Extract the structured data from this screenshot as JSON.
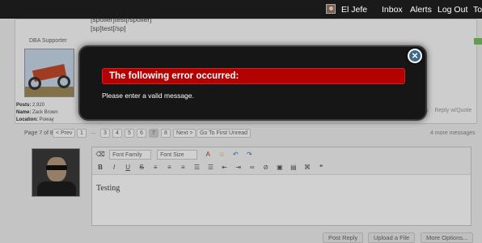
{
  "topbar": {
    "user_name": "El Jefe",
    "inbox": "Inbox",
    "alerts": "Alerts",
    "logout": "Log Out",
    "top": "To"
  },
  "post": {
    "user_title": "DBA Supporter",
    "quote_line_1": "[spoiler]test[/spoiler]",
    "quote_line_2": "[sp]test[/sp]",
    "posts_label": "Posts:",
    "posts_value": "2,920",
    "name_label": "Name:",
    "name_value": "Zack Brown",
    "location_label": "Location:",
    "location_value": "Poway",
    "likes_fragment": "es",
    "reply_quote": "Reply w/Quote"
  },
  "pagination": {
    "label": "Page 7 of 8",
    "prev": "< Prev",
    "pages": [
      "1",
      "…",
      "3",
      "4",
      "5",
      "6",
      "7",
      "8"
    ],
    "current_page": "7",
    "next": "Next >",
    "first_unread": "Go To First Unread",
    "more_messages": "4 more messages"
  },
  "editor": {
    "font_family": "Font Family",
    "font_size": "Font Size",
    "text": "Testing"
  },
  "form_buttons": {
    "post_reply": "Post Reply",
    "upload": "Upload a File",
    "more_options": "More Options..."
  },
  "modal": {
    "title": "The following error occurred:",
    "message": "Please enter a valid message."
  },
  "colors": {
    "error_header": "#b30000",
    "modal_background": "#161616",
    "close_button": "#3d6a8a",
    "topbar": "#1a1a1a"
  }
}
